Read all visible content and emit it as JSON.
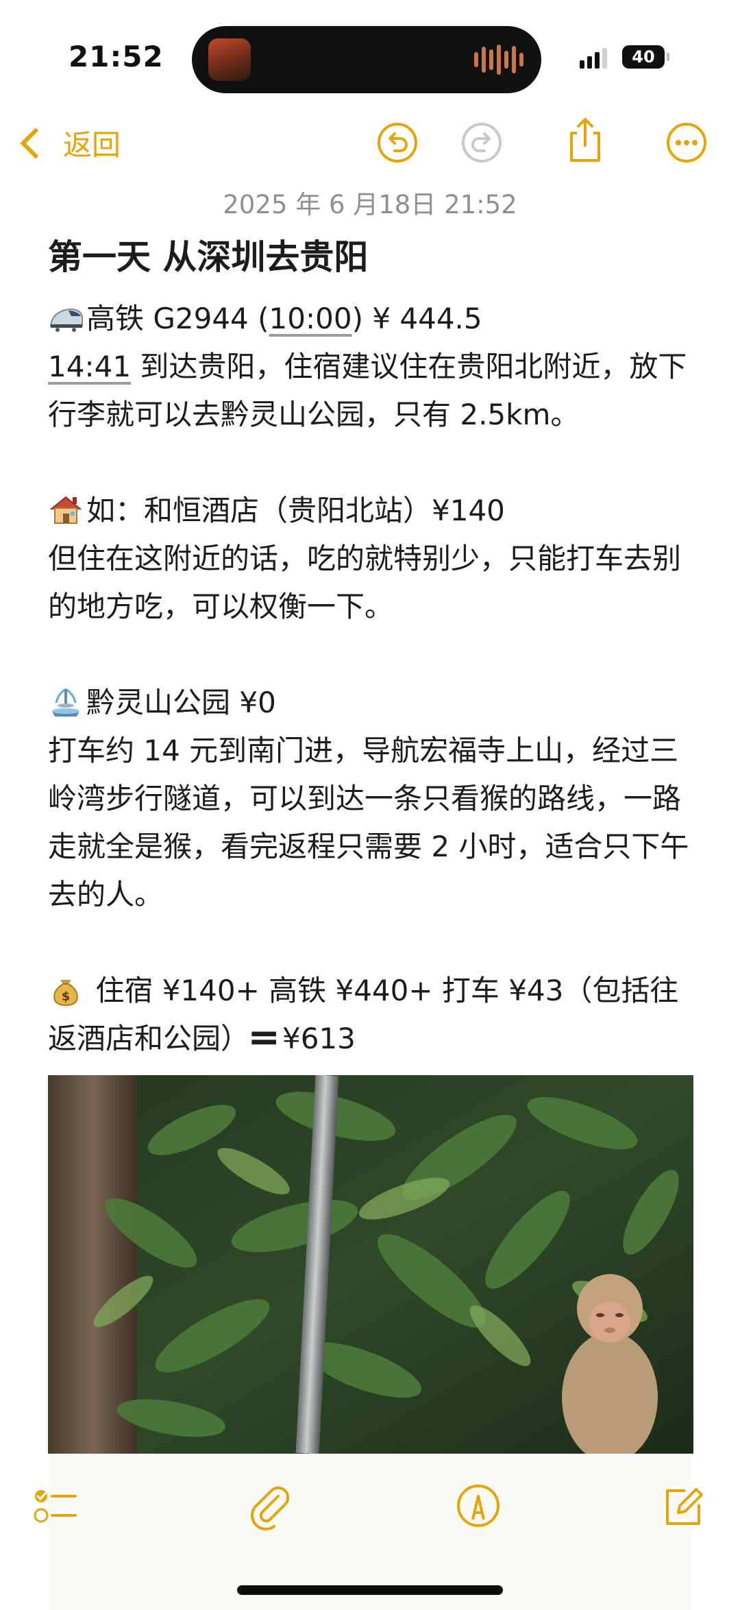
{
  "status_bar": {
    "time": "21:52",
    "battery": "40"
  },
  "nav": {
    "back_label": "返回"
  },
  "note": {
    "timestamp": "2025 年 6 月18日 21:52",
    "title": "第一天 从深圳去贵阳",
    "train_prefix": "高铁 G2944 (",
    "train_time": "10:00",
    "train_suffix": ") ¥ 444.5",
    "arrive_time": "14:41",
    "arrive_text": " 到达贵阳，住宿建议住在贵阳北附近，放下行李就可以去黔灵山公园，只有 2.5km。",
    "hotel_line": "如：和恒酒店（贵阳北站）¥140",
    "hotel_desc": "但住在这附近的话，吃的就特别少，只能打车去别的地方吃，可以权衡一下。",
    "park_line": "黔灵山公园 ¥0",
    "park_desc": "打车约 14 元到南门进，导航宏福寺上山，经过三岭湾步行隧道，可以到达一条只看猴的路线，一路走就全是猴，看完返程只需要 2 小时，适合只下午去的人。",
    "cost_line": " 住宿 ¥140+ 高铁 ¥440+ 打车 ¥43（包括往返酒店和公园）",
    "cost_total": "¥613"
  },
  "icons": {
    "train": "bullet-train-emoji",
    "hotel": "house-emoji",
    "park": "fountain-emoji",
    "money": "money-bag-emoji",
    "equals": "heavy-equals-emoji"
  },
  "colors": {
    "accent": "#e5a50a",
    "text": "#1c1c1e",
    "muted": "#8e8e93"
  }
}
